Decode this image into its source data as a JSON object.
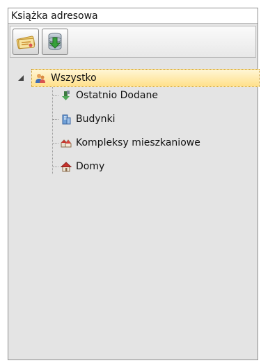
{
  "panel": {
    "title": "Książka adresowa"
  },
  "toolbar": {
    "buttons": [
      {
        "icon": "address-card-icon"
      },
      {
        "icon": "database-import-icon"
      }
    ]
  },
  "tree": {
    "root": {
      "label": "Wszystko",
      "icon": "contacts-icon",
      "expanded": true,
      "selected": true
    },
    "children": [
      {
        "label": "Ostatnio Dodane",
        "icon": "recent-icon"
      },
      {
        "label": "Budynki",
        "icon": "building-icon"
      },
      {
        "label": "Kompleksy mieszkaniowe",
        "icon": "housing-complex-icon"
      },
      {
        "label": "Domy",
        "icon": "house-icon"
      }
    ]
  },
  "colors": {
    "selection": "#ffe08a",
    "panel_bg": "#e4e4e4"
  }
}
